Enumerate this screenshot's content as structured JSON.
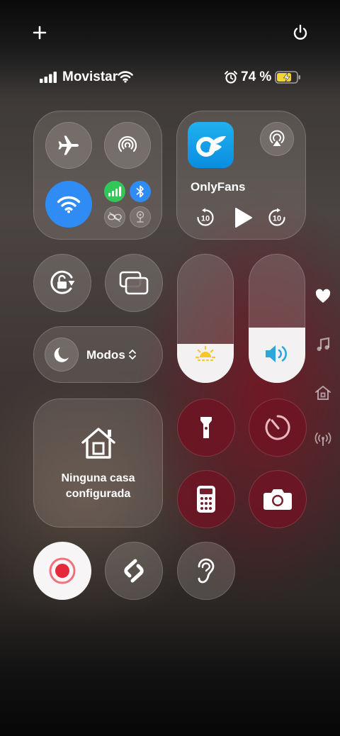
{
  "topbar": {
    "add_icon": "plus-icon",
    "power_icon": "power-icon"
  },
  "status_bar": {
    "carrier": "Movistar",
    "battery_percent": "74 %",
    "alarm_icon": "alarm-icon",
    "charging": true,
    "battery_level": 0.74
  },
  "connectivity": {
    "airplane_mode": false,
    "airdrop": false,
    "wifi": true,
    "cellular": true,
    "bluetooth": true
  },
  "now_playing": {
    "app_name": "OnlyFans",
    "skip_back": "10",
    "skip_forward": "10"
  },
  "modes": {
    "label": "Modos"
  },
  "brightness": {
    "level": 0.3
  },
  "volume": {
    "level": 0.43
  },
  "home": {
    "label_line1": "Ninguna casa",
    "label_line2": "configurada"
  },
  "side_nav": [
    "heart-icon",
    "music-note-icon",
    "home-icon",
    "antenna-icon"
  ]
}
